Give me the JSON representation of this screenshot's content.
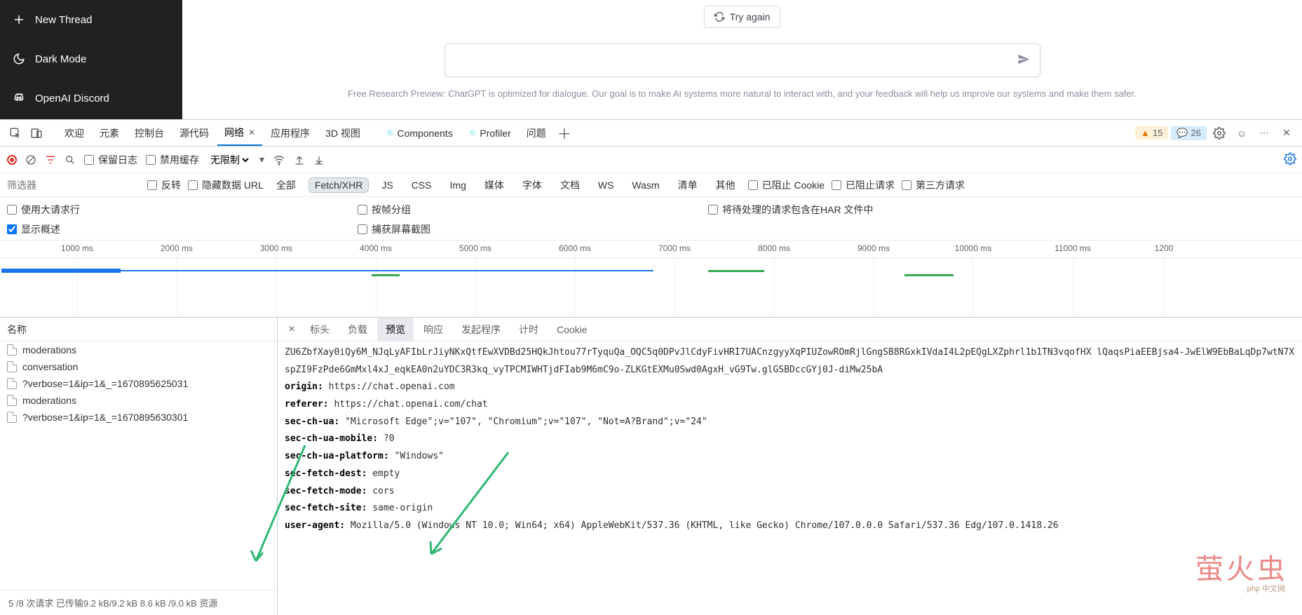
{
  "sidebar": {
    "new_thread": "New Thread",
    "dark_mode": "Dark Mode",
    "discord": "OpenAI Discord"
  },
  "chat": {
    "try_again": "Try again",
    "preview": "Free Research Preview: ChatGPT is optimized for dialogue. Our goal is to make AI systems more natural to interact with, and your feedback will help us improve our systems and make them safer."
  },
  "devtools_tabs": {
    "welcome": "欢迎",
    "elements": "元素",
    "console": "控制台",
    "sources": "源代码",
    "network": "网络",
    "application": "应用程序",
    "view3d": "3D 视图",
    "components": "Components",
    "profiler": "Profiler",
    "issues": "问题"
  },
  "badges": {
    "warn": "15",
    "info": "26"
  },
  "toolbar": {
    "preserve_log": "保留日志",
    "disable_cache": "禁用缓存",
    "throttle": "无限制"
  },
  "filter": {
    "placeholder": "筛选器",
    "invert": "反转",
    "hide_data": "隐藏数据 URL",
    "types": [
      "全部",
      "Fetch/XHR",
      "JS",
      "CSS",
      "Img",
      "媒体",
      "字体",
      "文档",
      "WS",
      "Wasm",
      "清单",
      "其他"
    ],
    "blocked_cookies": "已阻止 Cookie",
    "blocked_requests": "已阻止请求",
    "third_party": "第三方请求"
  },
  "options": {
    "large_rows": "使用大请求行",
    "show_overview": "显示概述",
    "group_by_frame": "按帧分组",
    "screenshots": "捕获屏幕截图",
    "include_har": "将待处理的请求包含在HAR 文件中"
  },
  "timeline": {
    "ticks": [
      "1000 ms",
      "2000 ms",
      "3000 ms",
      "4000 ms",
      "5000 ms",
      "6000 ms",
      "7000 ms",
      "8000 ms",
      "9000 ms",
      "10000 ms",
      "11000 ms",
      "1200"
    ]
  },
  "requests": {
    "header": "名称",
    "items": [
      "moderations",
      "conversation",
      "?verbose=1&ip=1&_=1670895625031",
      "moderations",
      "?verbose=1&ip=1&_=1670895630301"
    ],
    "status": "5 /8 次请求  已传输9.2 kB/9.2 kB  8.6 kB /9.0 kB 资源"
  },
  "detail_tabs": {
    "headers": "标头",
    "payload": "负载",
    "preview": "预览",
    "response": "响应",
    "initiator": "发起程序",
    "timing": "计时",
    "cookies": "Cookie"
  },
  "headers": {
    "token_frag": "ZU6ZbfXay0iQy6M_NJqLyAFIbLrJiyNKxQtfEwXVDBd25HQkJhtou77rTyquQa_OQC5q0DPvJlCdyFivHRI7UACnzgyyXqPIUZowROmRjlGngSB8RGxkIVdaI4L2pEQgLXZphrl1b1TN3vqofHX lQaqsPiaEEBjsa4-JwElW9EbBaLqDp7wtN7XspZI9FzPde6GmMxl4xJ_eqkEA0n2uYDC3R3kq_vyTPCMIWHTjdFIab9M6mC9o-ZLKGtEXMu0Swd0AgxH_vG9Tw.glGSBDccGYj0J-diMw25bA",
    "origin": {
      "k": "origin:",
      "v": "https://chat.openai.com"
    },
    "referer": {
      "k": "referer:",
      "v": "https://chat.openai.com/chat"
    },
    "sec_ch_ua": {
      "k": "sec-ch-ua:",
      "v": "\"Microsoft Edge\";v=\"107\", \"Chromium\";v=\"107\", \"Not=A?Brand\";v=\"24\""
    },
    "sec_ch_ua_mobile": {
      "k": "sec-ch-ua-mobile:",
      "v": "?0"
    },
    "sec_ch_ua_platform": {
      "k": "sec-ch-ua-platform:",
      "v": "\"Windows\""
    },
    "sec_fetch_dest": {
      "k": "sec-fetch-dest:",
      "v": "empty"
    },
    "sec_fetch_mode": {
      "k": "sec-fetch-mode:",
      "v": "cors"
    },
    "sec_fetch_site": {
      "k": "sec-fetch-site:",
      "v": "same-origin"
    },
    "user_agent": {
      "k": "user-agent:",
      "v": "Mozilla/5.0 (Windows NT 10.0; Win64; x64) AppleWebKit/537.36 (KHTML, like Gecko) Chrome/107.0.0.0 Safari/537.36 Edg/107.0.1418.26"
    }
  },
  "watermark": "萤火虫",
  "watermark2": "php 中文网"
}
